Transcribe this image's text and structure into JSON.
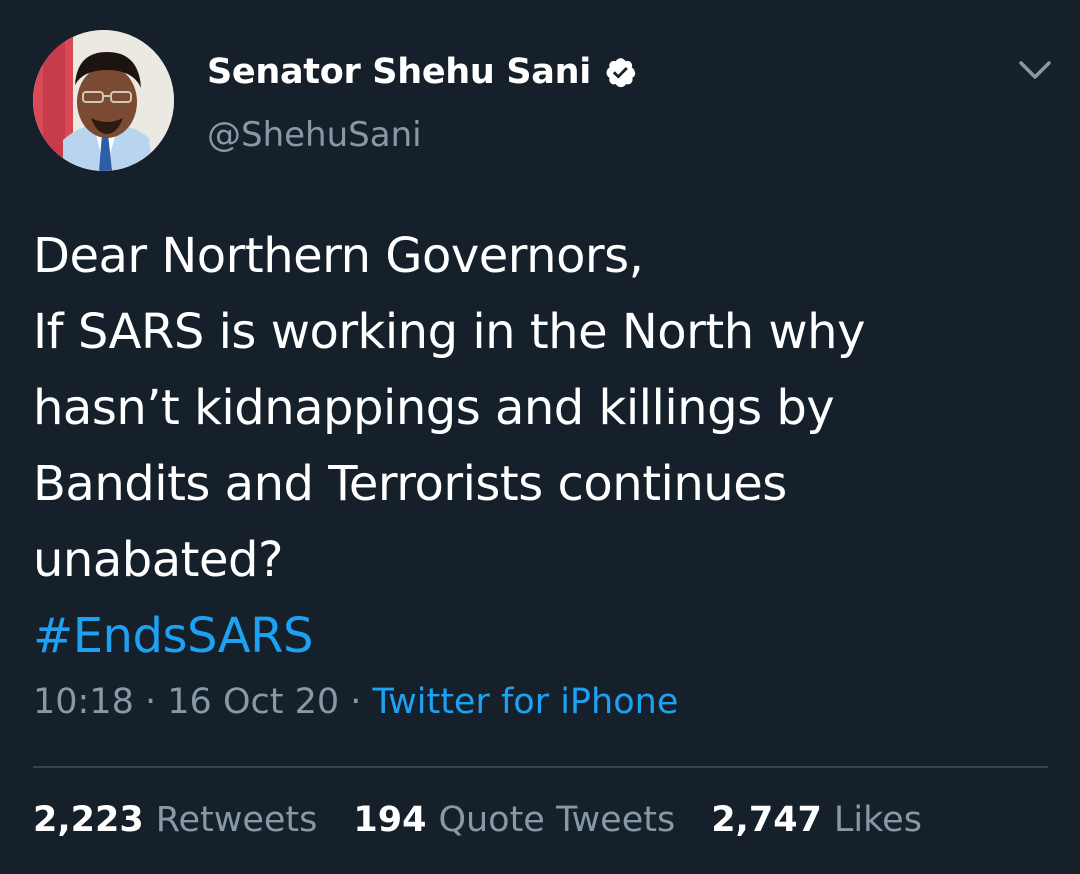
{
  "author": {
    "display_name": "Senator Shehu Sani",
    "handle": "@ShehuSani",
    "verified": true,
    "avatar_icon": "profile-photo"
  },
  "menu": {
    "icon": "chevron-down-icon"
  },
  "tweet": {
    "lines": [
      "Dear Northern Governors,",
      "If SARS is working in the North why",
      "hasn’t kidnappings and killings by",
      "Bandits and Terrorists continues",
      "unabated?"
    ],
    "hashtag": "#EndsSARS"
  },
  "meta": {
    "time": "10:18",
    "separator": "·",
    "date": "16 Oct 20",
    "source": "Twitter for iPhone"
  },
  "stats": {
    "retweets": {
      "count": "2,223",
      "label": "Retweets"
    },
    "quote_tweets": {
      "count": "194",
      "label": "Quote Tweets"
    },
    "likes": {
      "count": "2,747",
      "label": "Likes"
    }
  },
  "colors": {
    "background": "#15202b",
    "text": "#ffffff",
    "muted": "#8899a6",
    "accent": "#1da1f2",
    "divider": "#38444d"
  }
}
